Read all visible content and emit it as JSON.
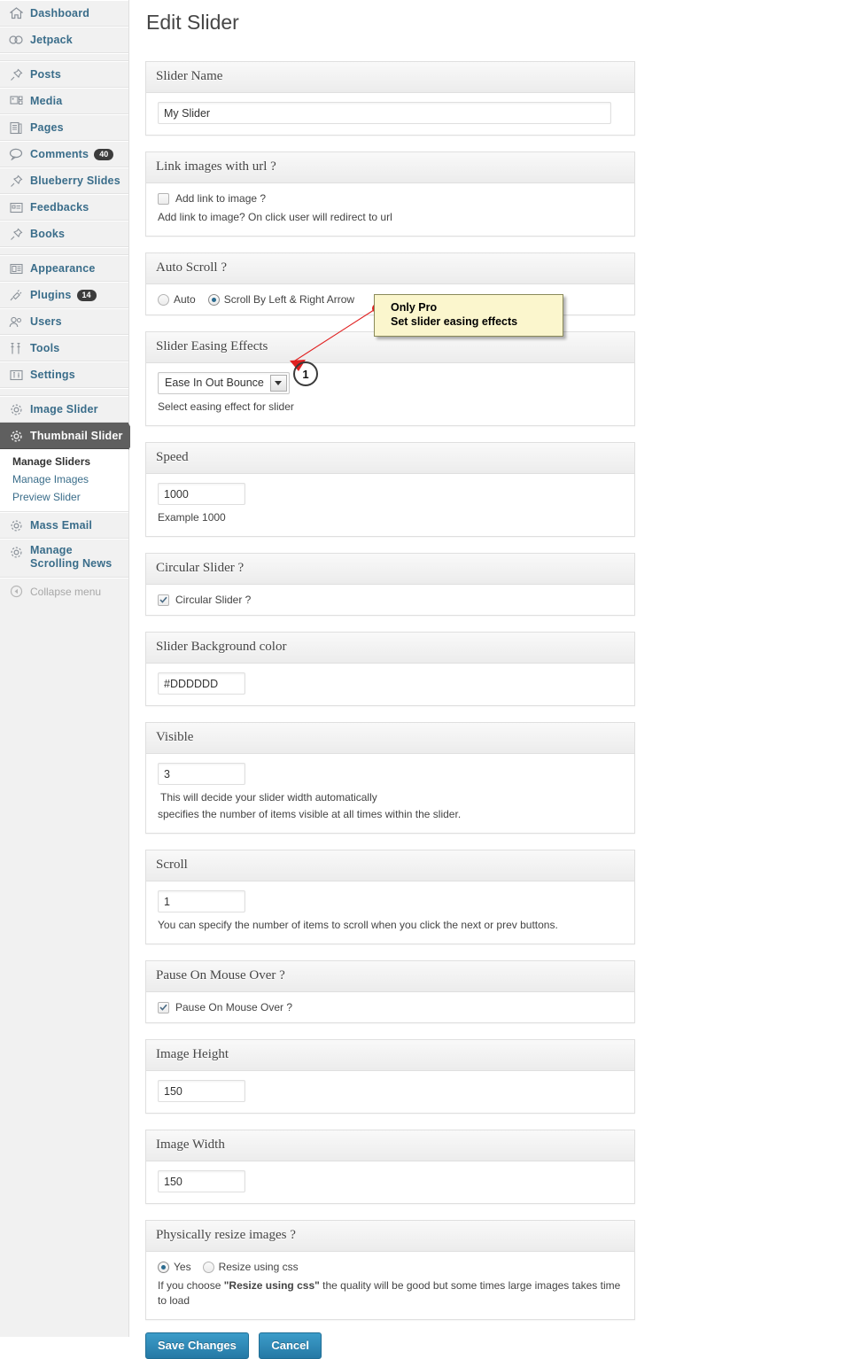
{
  "sidebar": {
    "items": [
      {
        "label": "Dashboard",
        "icon": "dashboard-icon",
        "badge": null
      },
      {
        "label": "Jetpack",
        "icon": "jetpack-icon",
        "badge": null
      },
      {
        "label": "Posts",
        "icon": "pin-icon",
        "badge": null
      },
      {
        "label": "Media",
        "icon": "media-icon",
        "badge": null
      },
      {
        "label": "Pages",
        "icon": "pages-icon",
        "badge": null
      },
      {
        "label": "Comments",
        "icon": "comment-bubble-icon",
        "badge": "40"
      },
      {
        "label": "Blueberry Slides",
        "icon": "pin-icon",
        "badge": null
      },
      {
        "label": "Feedbacks",
        "icon": "feedback-icon",
        "badge": null
      },
      {
        "label": "Books",
        "icon": "pin-icon",
        "badge": null
      },
      {
        "label": "Appearance",
        "icon": "appearance-icon",
        "badge": null
      },
      {
        "label": "Plugins",
        "icon": "plug-icon",
        "badge": "14"
      },
      {
        "label": "Users",
        "icon": "users-icon",
        "badge": null
      },
      {
        "label": "Tools",
        "icon": "tools-icon",
        "badge": null
      },
      {
        "label": "Settings",
        "icon": "settings-icon",
        "badge": null
      },
      {
        "label": "Image Slider",
        "icon": "gear-icon",
        "badge": null
      },
      {
        "label": "Thumbnail Slider",
        "icon": "gear-icon",
        "badge": null
      },
      {
        "label": "Mass Email",
        "icon": "gear-icon",
        "badge": null
      },
      {
        "label": "Manage Scrolling News",
        "icon": "gear-icon",
        "badge": null
      }
    ],
    "submenu": [
      {
        "label": "Manage Sliders",
        "active": true
      },
      {
        "label": "Manage Images",
        "active": false
      },
      {
        "label": "Preview Slider",
        "active": false
      }
    ],
    "collapse_label": "Collapse menu",
    "active_item": "Thumbnail Slider",
    "accent_color": "#3a6d8a",
    "active_bg": "#5f5f5f"
  },
  "page": {
    "title": "Edit Slider"
  },
  "sections": {
    "slider_name": {
      "heading": "Slider Name",
      "value": "My Slider"
    },
    "link_images": {
      "heading": "Link images with url ?",
      "checkbox_label": "Add link to image ?",
      "checked": false,
      "help": "Add link to image? On click user will redirect to url"
    },
    "auto_scroll": {
      "heading": "Auto Scroll ?",
      "options": [
        {
          "label": "Auto",
          "selected": false
        },
        {
          "label": "Scroll By Left & Right Arrow",
          "selected": true
        }
      ]
    },
    "easing": {
      "heading": "Slider Easing Effects",
      "selected": "Ease In Out Bounce",
      "help": "Select easing effect for slider"
    },
    "speed": {
      "heading": "Speed",
      "value": "1000",
      "help": "Example 1000"
    },
    "circular": {
      "heading": "Circular Slider ?",
      "checkbox_label": "Circular Slider ?",
      "checked": true
    },
    "bgcolor": {
      "heading": "Slider Background color",
      "value": "#DDDDDD"
    },
    "visible": {
      "heading": "Visible",
      "value": "3",
      "help1": "This will decide your slider width automatically",
      "help2": "specifies the number of items visible at all times within the slider."
    },
    "scroll": {
      "heading": "Scroll",
      "value": "1",
      "help": "You can specify the number of items to scroll when you click the next or prev buttons."
    },
    "pause": {
      "heading": "Pause On Mouse Over ?",
      "checkbox_label": "Pause On Mouse Over ?",
      "checked": true
    },
    "image_height": {
      "heading": "Image Height",
      "value": "150"
    },
    "image_width": {
      "heading": "Image Width",
      "value": "150"
    },
    "resize": {
      "heading": "Physically resize images ?",
      "options": [
        {
          "label": "Yes",
          "selected": true
        },
        {
          "label": "Resize using css",
          "selected": false
        }
      ],
      "help_before": "If you choose ",
      "help_bold": "\"Resize using css\"",
      "help_after": " the quality will be good but some times large images takes time to load"
    }
  },
  "actions": {
    "save_label": "Save Changes",
    "cancel_label": "Cancel",
    "button_color": "#2579a5"
  },
  "annotation": {
    "callout_line1": "Only Pro",
    "callout_line2": "Set slider easing effects",
    "marker_number": "1",
    "callout_bg": "#fbf6cd",
    "pointer_color": "#e00000"
  }
}
